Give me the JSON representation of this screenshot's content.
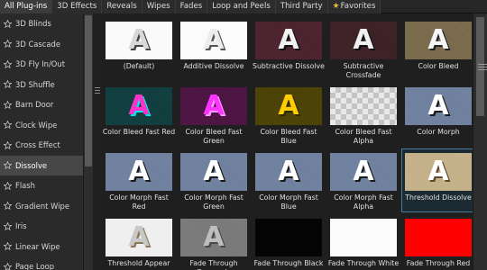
{
  "tabs": [
    {
      "label": "All Plug-ins",
      "active": true
    },
    {
      "label": "3D Effects",
      "active": false
    },
    {
      "label": "Reveals",
      "active": false
    },
    {
      "label": "Wipes",
      "active": false
    },
    {
      "label": "Fades",
      "active": false
    },
    {
      "label": "Loop and Peels",
      "active": false
    },
    {
      "label": "Third Party",
      "active": false
    },
    {
      "label": "Favorites",
      "active": false,
      "icon": "star-icon"
    }
  ],
  "sidebar": {
    "items": [
      {
        "label": "3D Blinds"
      },
      {
        "label": "3D Cascade"
      },
      {
        "label": "3D Fly In/Out"
      },
      {
        "label": "3D Shuffle"
      },
      {
        "label": "Barn Door"
      },
      {
        "label": "Clock Wipe"
      },
      {
        "label": "Cross Effect"
      },
      {
        "label": "Dissolve",
        "selected": true
      },
      {
        "label": "Flash"
      },
      {
        "label": "Gradient Wipe"
      },
      {
        "label": "Iris"
      },
      {
        "label": "Linear Wipe"
      },
      {
        "label": "Page Loop"
      }
    ],
    "item_icon": "star-outline-icon"
  },
  "presets": [
    {
      "label": "(Default)",
      "thumb": "default"
    },
    {
      "label": "Additive Dissolve",
      "thumb": "additive"
    },
    {
      "label": "Subtractive Dissolve",
      "thumb": "subtractive"
    },
    {
      "label": "Subtractive Crossfade",
      "thumb": "subcross"
    },
    {
      "label": "Color Bleed",
      "thumb": "bleed"
    },
    {
      "label": "Color Bleed Fast Red",
      "thumb": "bleed-red"
    },
    {
      "label": "Color Bleed Fast Green",
      "thumb": "bleed-green"
    },
    {
      "label": "Color Bleed Fast Blue",
      "thumb": "bleed-blue"
    },
    {
      "label": "Color Bleed Fast Alpha",
      "thumb": "bleed-alpha"
    },
    {
      "label": "Color Morph",
      "thumb": "morph"
    },
    {
      "label": "Color Morph Fast Red",
      "thumb": "morph-red"
    },
    {
      "label": "Color Morph Fast Green",
      "thumb": "morph-green"
    },
    {
      "label": "Color Morph Fast Blue",
      "thumb": "morph-blue"
    },
    {
      "label": "Color Morph Fast Alpha",
      "thumb": "morph-alpha"
    },
    {
      "label": "Threshold Dissolve",
      "thumb": "threshold",
      "selected": true
    },
    {
      "label": "Threshold Appear",
      "thumb": "thr-appear"
    },
    {
      "label": "Fade Through Grayscale",
      "thumb": "fade-gray"
    },
    {
      "label": "Fade Through Black",
      "thumb": "fade-black"
    },
    {
      "label": "Fade Through White",
      "thumb": "fade-white"
    },
    {
      "label": "Fade Through Red",
      "thumb": "fade-red"
    }
  ],
  "glyph": "A",
  "colors": {
    "selection_border": "#4a7d9a",
    "favorite_star": "#e8b93a",
    "fade_red": "#ff0000"
  }
}
